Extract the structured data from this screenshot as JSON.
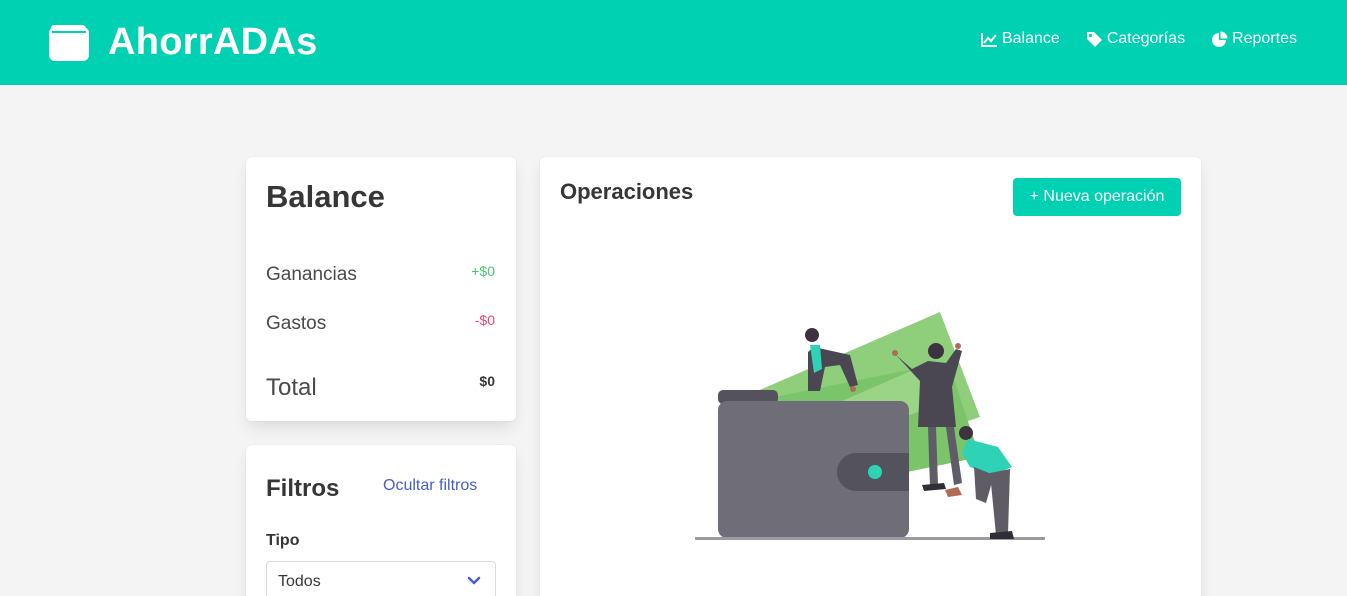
{
  "navbar": {
    "brand_title": "AhorrADAs",
    "brand_icon": "wallet-icon",
    "items": [
      {
        "label": "Balance",
        "icon": "chart-line-icon"
      },
      {
        "label": "Categorías",
        "icon": "tag-icon"
      },
      {
        "label": "Reportes",
        "icon": "chart-pie-icon"
      }
    ]
  },
  "balance": {
    "title": "Balance",
    "ganancias_label": "Ganancias",
    "ganancias_value": "+$0",
    "gastos_label": "Gastos",
    "gastos_value": "-$0",
    "total_label": "Total",
    "total_value": "$0"
  },
  "filters": {
    "title": "Filtros",
    "hide_label": "Ocultar filtros",
    "tipo_label": "Tipo",
    "tipo_value": "Todos"
  },
  "operations": {
    "title": "Operaciones",
    "new_button_label": "+ Nueva operación",
    "illustration": "empty-wallet-illustration"
  },
  "colors": {
    "primary": "#00d1b2",
    "success": "#48c774",
    "danger": "#f14668",
    "link": "#485fc7",
    "background": "#f4f4f4"
  }
}
